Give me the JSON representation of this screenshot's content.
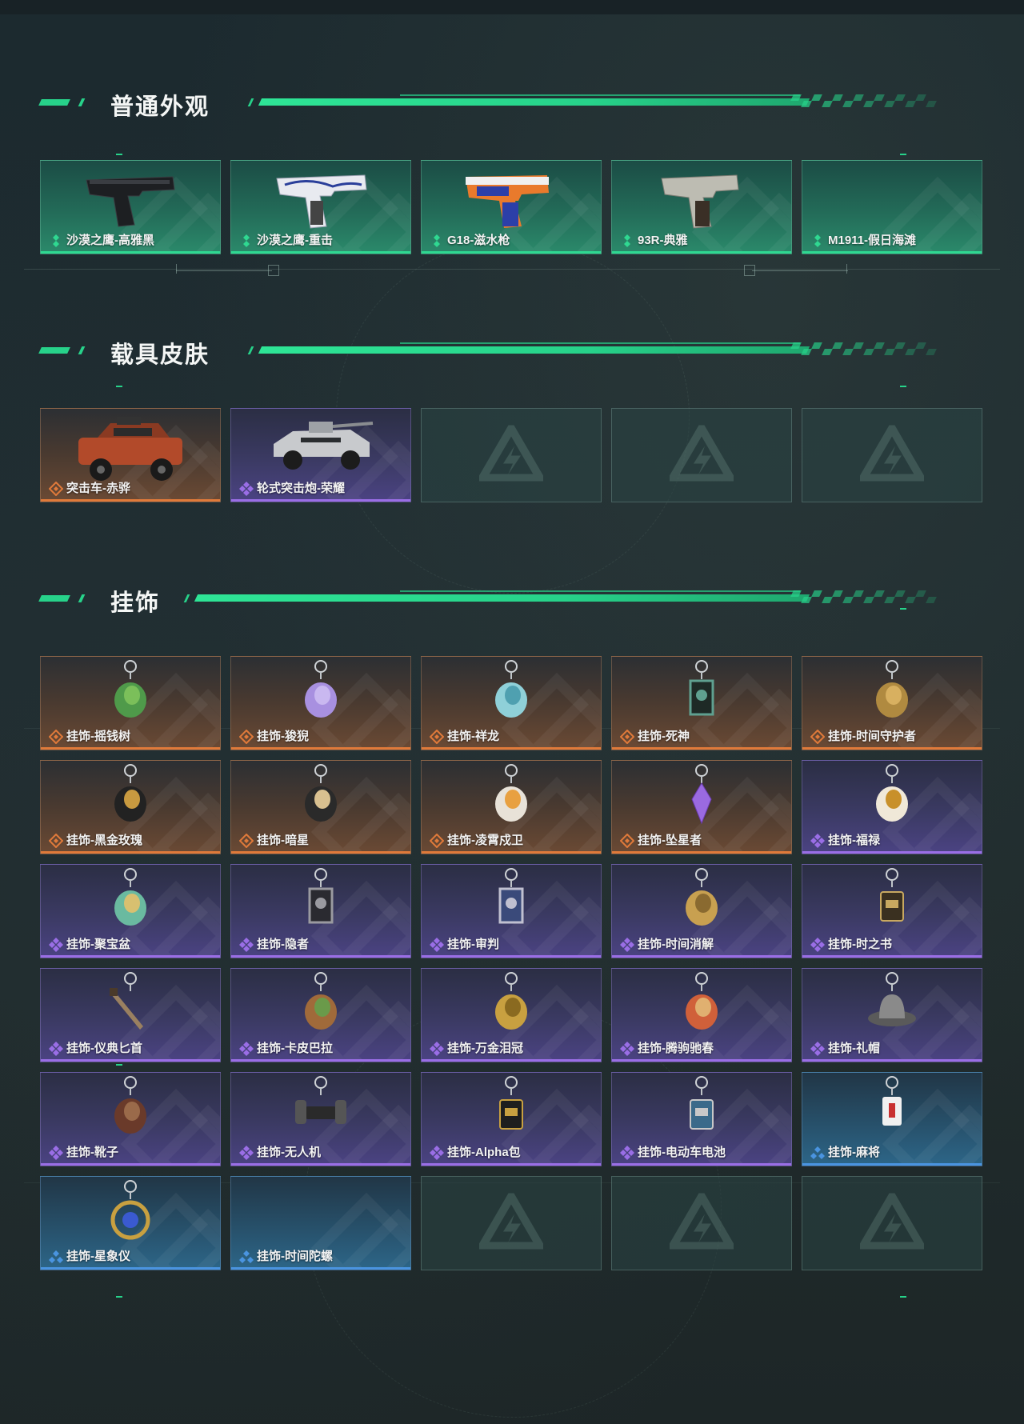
{
  "colors": {
    "accent": "#27d28a",
    "rarity_green": "#2fd891",
    "rarity_orange": "#e07a3a",
    "rarity_purple": "#9a6ee6",
    "rarity_blue": "#4a94e0"
  },
  "sections": [
    {
      "title": "普通外观",
      "items": [
        {
          "label": "沙漠之鹰-高雅黑",
          "rarity": "green",
          "icon": "pistol-black-icon"
        },
        {
          "label": "沙漠之鹰-重击",
          "rarity": "green",
          "icon": "pistol-white-blue-icon"
        },
        {
          "label": "G18-滋水枪",
          "rarity": "green",
          "icon": "water-pistol-icon"
        },
        {
          "label": "93R-典雅",
          "rarity": "green",
          "icon": "pistol-silver-icon"
        },
        {
          "label": "M1911-假日海滩",
          "rarity": "green",
          "icon": ""
        }
      ]
    },
    {
      "title": "载具皮肤",
      "items": [
        {
          "label": "突击车-赤骅",
          "rarity": "orange",
          "icon": "assault-vehicle-icon"
        },
        {
          "label": "轮式突击炮-荣耀",
          "rarity": "purple",
          "icon": "wheeled-gun-icon"
        },
        {
          "label": "",
          "rarity": "empty",
          "icon": "placeholder-logo-icon"
        },
        {
          "label": "",
          "rarity": "empty",
          "icon": "placeholder-logo-icon"
        },
        {
          "label": "",
          "rarity": "empty",
          "icon": "placeholder-logo-icon"
        }
      ]
    },
    {
      "title": "挂饰",
      "items": [
        {
          "label": "挂饰-摇钱树",
          "rarity": "orange",
          "icon": "money-tree-charm-icon"
        },
        {
          "label": "挂饰-狻猊",
          "rarity": "orange",
          "icon": "lion-charm-icon"
        },
        {
          "label": "挂饰-祥龙",
          "rarity": "orange",
          "icon": "dragon-charm-icon"
        },
        {
          "label": "挂饰-死神",
          "rarity": "orange",
          "icon": "reaper-card-charm-icon"
        },
        {
          "label": "挂饰-时间守护者",
          "rarity": "orange",
          "icon": "time-keeper-charm-icon"
        },
        {
          "label": "挂饰-黑金玫瑰",
          "rarity": "orange",
          "icon": "black-gold-rose-charm-icon"
        },
        {
          "label": "挂饰-暗星",
          "rarity": "orange",
          "icon": "dark-star-charm-icon"
        },
        {
          "label": "挂饰-凌霄戍卫",
          "rarity": "orange",
          "icon": "guardian-charm-icon"
        },
        {
          "label": "挂饰-坠星者",
          "rarity": "orange",
          "icon": "crystal-charm-icon"
        },
        {
          "label": "挂饰-福禄",
          "rarity": "purple",
          "icon": "gourd-charm-icon"
        },
        {
          "label": "挂饰-聚宝盆",
          "rarity": "purple",
          "icon": "treasure-bowl-charm-icon"
        },
        {
          "label": "挂饰-隐者",
          "rarity": "purple",
          "icon": "hermit-card-charm-icon"
        },
        {
          "label": "挂饰-审判",
          "rarity": "purple",
          "icon": "judgement-card-charm-icon"
        },
        {
          "label": "挂饰-时间消解",
          "rarity": "purple",
          "icon": "time-dissolve-charm-icon"
        },
        {
          "label": "挂饰-时之书",
          "rarity": "purple",
          "icon": "book-charm-icon"
        },
        {
          "label": "挂饰-仪典匕首",
          "rarity": "purple",
          "icon": "dagger-charm-icon"
        },
        {
          "label": "挂饰-卡皮巴拉",
          "rarity": "purple",
          "icon": "capybara-charm-icon"
        },
        {
          "label": "挂饰-万金泪冠",
          "rarity": "purple",
          "icon": "crown-charm-icon"
        },
        {
          "label": "挂饰-腾驹驰春",
          "rarity": "purple",
          "icon": "carriage-charm-icon"
        },
        {
          "label": "挂饰-礼帽",
          "rarity": "purple",
          "icon": "hat-charm-icon"
        },
        {
          "label": "挂饰-靴子",
          "rarity": "purple",
          "icon": "boot-charm-icon"
        },
        {
          "label": "挂饰-无人机",
          "rarity": "purple",
          "icon": "drone-charm-icon"
        },
        {
          "label": "挂饰-Alpha包",
          "rarity": "purple",
          "icon": "bag-charm-icon"
        },
        {
          "label": "挂饰-电动车电池",
          "rarity": "purple",
          "icon": "battery-charm-icon"
        },
        {
          "label": "挂饰-麻将",
          "rarity": "blue",
          "icon": "mahjong-charm-icon"
        },
        {
          "label": "挂饰-星象仪",
          "rarity": "blue",
          "icon": "astrolabe-charm-icon"
        },
        {
          "label": "挂饰-时间陀螺",
          "rarity": "blue",
          "icon": ""
        },
        {
          "label": "",
          "rarity": "empty",
          "icon": "placeholder-logo-icon"
        },
        {
          "label": "",
          "rarity": "empty",
          "icon": "placeholder-logo-icon"
        },
        {
          "label": "",
          "rarity": "empty",
          "icon": "placeholder-logo-icon"
        }
      ]
    }
  ]
}
